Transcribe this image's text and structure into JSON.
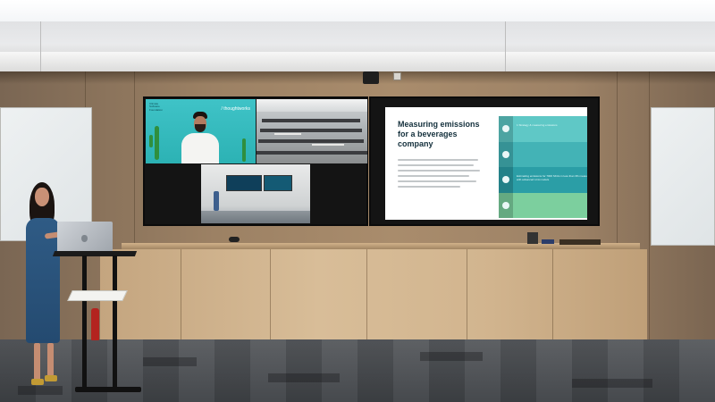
{
  "scene": {
    "description_free": true
  },
  "screen_left": {
    "speaker_tile": {
      "brand_label": "/ thoughtworks",
      "sponsor_lines": [
        "Climate",
        "Software",
        "Foundation"
      ]
    }
  },
  "screen_right": {
    "slide": {
      "title": "Measuring emissions for a beverages company",
      "blocks": [
        {
          "text": "1 Strategy & measuring emissions",
          "color": "#5fc8c6",
          "icon": "gear-icon"
        },
        {
          "text": "",
          "color": "#43b3b6",
          "icon": "chart-icon"
        },
        {
          "text": "Estimating emissions for 7000 SKUs in less than 3% measured with advanced LCA models",
          "color": "#2b9ea6",
          "icon": "leaf-icon"
        },
        {
          "text": "",
          "color": "#7ccf9e",
          "icon": "check-icon"
        }
      ]
    }
  },
  "colors": {
    "slide_teal": "#2b9ea6",
    "tile_teal": "#2cb2b4",
    "dress_blue": "#2f5b85",
    "wall_wood": "#a98c6c"
  }
}
